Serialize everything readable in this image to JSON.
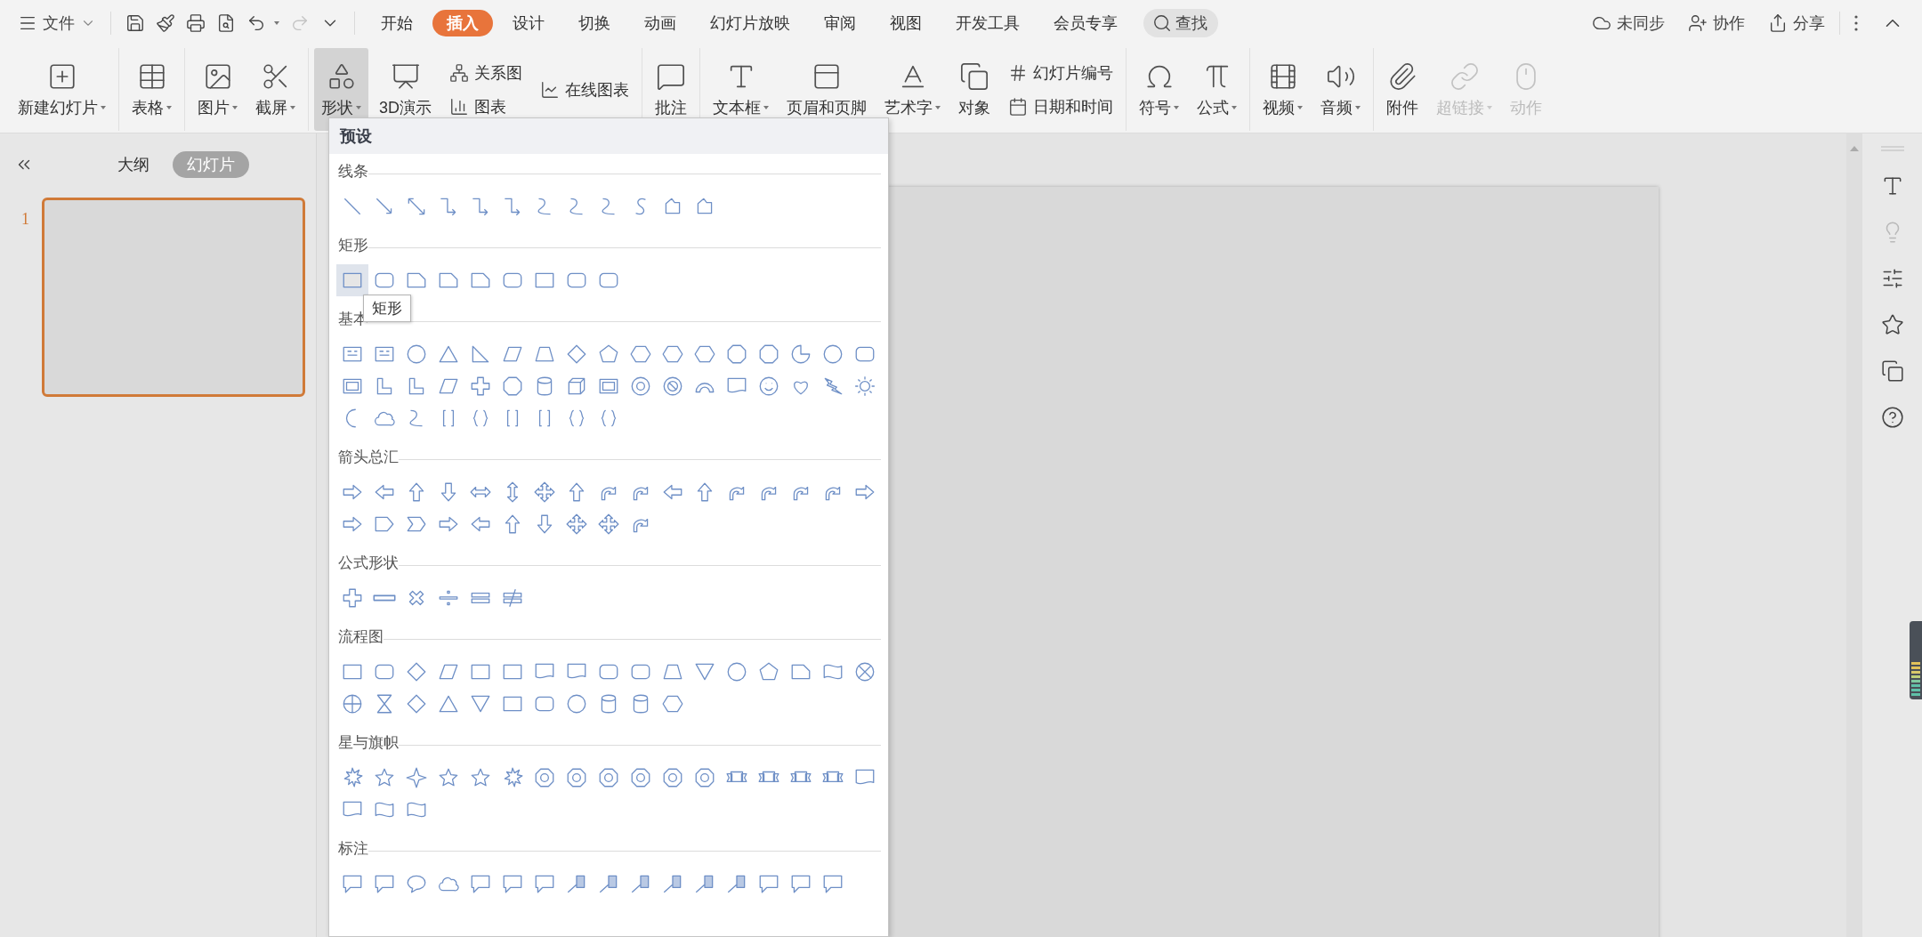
{
  "menu": {
    "label": "文件"
  },
  "quick_tools": [
    {
      "disabled": false
    },
    {
      "disabled": false
    },
    {
      "disabled": false
    },
    {
      "disabled": false
    },
    {
      "disabled": false
    },
    {
      "disabled": true
    },
    {
      "disabled": false
    }
  ],
  "tabs": [
    {
      "label": "开始",
      "selected": false
    },
    {
      "label": "插入",
      "selected": true
    },
    {
      "label": "设计",
      "selected": false
    },
    {
      "label": "切换",
      "selected": false
    },
    {
      "label": "动画",
      "selected": false
    },
    {
      "label": "幻灯片放映",
      "selected": false
    },
    {
      "label": "审阅",
      "selected": false
    },
    {
      "label": "视图",
      "selected": false
    },
    {
      "label": "开发工具",
      "selected": false
    },
    {
      "label": "会员专享",
      "selected": false
    }
  ],
  "search": {
    "label": "查找"
  },
  "account_actions": [
    {
      "label": "未同步"
    },
    {
      "label": "协作"
    },
    {
      "label": "分享"
    }
  ],
  "ribbon": {
    "groups": [
      {
        "items": [
          {
            "kind": "large",
            "label": "新建幻灯片",
            "dropdown": true,
            "pressed": false,
            "disabled": false
          }
        ]
      },
      {
        "items": [
          {
            "kind": "large",
            "label": "表格",
            "dropdown": true,
            "pressed": false,
            "disabled": false
          }
        ]
      },
      {
        "items": [
          {
            "kind": "large",
            "label": "图片",
            "dropdown": true,
            "pressed": false,
            "disabled": false
          },
          {
            "kind": "large",
            "label": "截屏",
            "dropdown": true,
            "pressed": false,
            "disabled": false
          }
        ]
      },
      {
        "items": [
          {
            "kind": "large",
            "label": "形状",
            "dropdown": true,
            "pressed": true,
            "disabled": false
          },
          {
            "kind": "large",
            "label": "3D演示",
            "dropdown": false,
            "pressed": false,
            "disabled": false
          },
          {
            "kind": "stack",
            "items": [
              {
                "label": "关系图"
              },
              {
                "label": "图表"
              }
            ]
          },
          {
            "kind": "stack",
            "items": [
              {
                "label": "在线图表"
              }
            ]
          }
        ]
      },
      {
        "items": [
          {
            "kind": "large",
            "label": "批注",
            "dropdown": false,
            "pressed": false,
            "disabled": false
          }
        ]
      },
      {
        "items": [
          {
            "kind": "large",
            "label": "文本框",
            "dropdown": true,
            "pressed": false,
            "disabled": false
          },
          {
            "kind": "large",
            "label": "页眉和页脚",
            "dropdown": false,
            "pressed": false,
            "disabled": false
          },
          {
            "kind": "large",
            "label": "艺术字",
            "dropdown": true,
            "pressed": false,
            "disabled": false
          },
          {
            "kind": "large",
            "label": "对象",
            "dropdown": false,
            "pressed": false,
            "disabled": false
          },
          {
            "kind": "stack",
            "items": [
              {
                "label": "幻灯片编号"
              },
              {
                "label": "日期和时间"
              }
            ]
          }
        ]
      },
      {
        "items": [
          {
            "kind": "large",
            "label": "符号",
            "dropdown": true,
            "pressed": false,
            "disabled": false
          },
          {
            "kind": "large",
            "label": "公式",
            "dropdown": true,
            "pressed": false,
            "disabled": false
          }
        ]
      },
      {
        "items": [
          {
            "kind": "large",
            "label": "视频",
            "dropdown": true,
            "pressed": false,
            "disabled": false
          },
          {
            "kind": "large",
            "label": "音频",
            "dropdown": true,
            "pressed": false,
            "disabled": false
          }
        ]
      },
      {
        "items": [
          {
            "kind": "large",
            "label": "附件",
            "dropdown": false,
            "pressed": false,
            "disabled": false
          },
          {
            "kind": "large",
            "label": "超链接",
            "dropdown": true,
            "pressed": false,
            "disabled": true
          },
          {
            "kind": "large",
            "label": "动作",
            "dropdown": false,
            "pressed": false,
            "disabled": true
          }
        ]
      }
    ]
  },
  "view_tabs": [
    {
      "label": "大纲",
      "selected": false
    },
    {
      "label": "幻灯片",
      "selected": true
    }
  ],
  "slides": [
    {
      "number": "1",
      "selected": true
    }
  ],
  "side_tools": [
    {
      "disabled": false
    },
    {
      "disabled": true
    },
    {
      "disabled": false
    },
    {
      "disabled": false
    },
    {
      "disabled": false
    },
    {
      "disabled": false
    }
  ],
  "shape_menu": {
    "header": "预设",
    "tooltip": "矩形",
    "sections": [
      {
        "title": "线条",
        "shapes": [
          {
            "selected": false
          },
          {
            "selected": false
          },
          {
            "selected": false
          },
          {
            "selected": false
          },
          {
            "selected": false
          },
          {
            "selected": false
          },
          {
            "selected": false
          },
          {
            "selected": false
          },
          {
            "selected": false
          },
          {
            "selected": false
          },
          {
            "selected": false
          },
          {
            "selected": false
          }
        ]
      },
      {
        "title": "矩形",
        "shapes": [
          {
            "selected": true
          },
          {
            "selected": false
          },
          {
            "selected": false
          },
          {
            "selected": false
          },
          {
            "selected": false
          },
          {
            "selected": false
          },
          {
            "selected": false
          },
          {
            "selected": false
          },
          {
            "selected": false
          }
        ]
      },
      {
        "title": "基本",
        "shapes": [
          {
            "selected": false
          },
          {
            "selected": false
          },
          {
            "selected": false
          },
          {
            "selected": false
          },
          {
            "selected": false
          },
          {
            "selected": false
          },
          {
            "selected": false
          },
          {
            "selected": false
          },
          {
            "selected": false
          },
          {
            "selected": false
          },
          {
            "selected": false
          },
          {
            "selected": false
          },
          {
            "selected": false
          },
          {
            "selected": false
          },
          {
            "selected": false
          },
          {
            "selected": false
          },
          {
            "selected": false
          },
          {
            "selected": false
          },
          {
            "selected": false
          },
          {
            "selected": false
          },
          {
            "selected": false
          },
          {
            "selected": false
          },
          {
            "selected": false
          },
          {
            "selected": false
          },
          {
            "selected": false
          },
          {
            "selected": false
          },
          {
            "selected": false
          },
          {
            "selected": false
          },
          {
            "selected": false
          },
          {
            "selected": false
          },
          {
            "selected": false
          },
          {
            "selected": false
          },
          {
            "selected": false
          },
          {
            "selected": false
          },
          {
            "selected": false
          },
          {
            "selected": false
          },
          {
            "selected": false
          },
          {
            "selected": false
          },
          {
            "selected": false
          },
          {
            "selected": false
          },
          {
            "selected": false
          },
          {
            "selected": false
          },
          {
            "selected": false
          }
        ]
      },
      {
        "title": "箭头总汇",
        "shapes": [
          {
            "selected": false
          },
          {
            "selected": false
          },
          {
            "selected": false
          },
          {
            "selected": false
          },
          {
            "selected": false
          },
          {
            "selected": false
          },
          {
            "selected": false
          },
          {
            "selected": false
          },
          {
            "selected": false
          },
          {
            "selected": false
          },
          {
            "selected": false
          },
          {
            "selected": false
          },
          {
            "selected": false
          },
          {
            "selected": false
          },
          {
            "selected": false
          },
          {
            "selected": false
          },
          {
            "selected": false
          },
          {
            "selected": false
          },
          {
            "selected": false
          },
          {
            "selected": false
          },
          {
            "selected": false
          },
          {
            "selected": false
          },
          {
            "selected": false
          },
          {
            "selected": false
          },
          {
            "selected": false
          },
          {
            "selected": false
          },
          {
            "selected": false
          }
        ]
      },
      {
        "title": "公式形状",
        "shapes": [
          {
            "selected": false
          },
          {
            "selected": false
          },
          {
            "selected": false
          },
          {
            "selected": false
          },
          {
            "selected": false
          },
          {
            "selected": false
          }
        ]
      },
      {
        "title": "流程图",
        "shapes": [
          {
            "selected": false
          },
          {
            "selected": false
          },
          {
            "selected": false
          },
          {
            "selected": false
          },
          {
            "selected": false
          },
          {
            "selected": false
          },
          {
            "selected": false
          },
          {
            "selected": false
          },
          {
            "selected": false
          },
          {
            "selected": false
          },
          {
            "selected": false
          },
          {
            "selected": false
          },
          {
            "selected": false
          },
          {
            "selected": false
          },
          {
            "selected": false
          },
          {
            "selected": false
          },
          {
            "selected": false
          },
          {
            "selected": false
          },
          {
            "selected": false
          },
          {
            "selected": false
          },
          {
            "selected": false
          },
          {
            "selected": false
          },
          {
            "selected": false
          },
          {
            "selected": false
          },
          {
            "selected": false
          },
          {
            "selected": false
          },
          {
            "selected": false
          },
          {
            "selected": false
          }
        ]
      },
      {
        "title": "星与旗帜",
        "shapes": [
          {
            "selected": false
          },
          {
            "selected": false
          },
          {
            "selected": false
          },
          {
            "selected": false
          },
          {
            "selected": false
          },
          {
            "selected": false
          },
          {
            "selected": false
          },
          {
            "selected": false
          },
          {
            "selected": false
          },
          {
            "selected": false
          },
          {
            "selected": false
          },
          {
            "selected": false
          },
          {
            "selected": false
          },
          {
            "selected": false
          },
          {
            "selected": false
          },
          {
            "selected": false
          },
          {
            "selected": false
          },
          {
            "selected": false
          },
          {
            "selected": false
          },
          {
            "selected": false
          }
        ]
      },
      {
        "title": "标注",
        "shapes": [
          {
            "selected": false
          },
          {
            "selected": false
          },
          {
            "selected": false
          },
          {
            "selected": false
          },
          {
            "selected": false
          },
          {
            "selected": false
          },
          {
            "selected": false
          },
          {
            "selected": false
          },
          {
            "selected": false
          },
          {
            "selected": false
          },
          {
            "selected": false
          },
          {
            "selected": false
          },
          {
            "selected": false
          },
          {
            "selected": false
          },
          {
            "selected": false
          },
          {
            "selected": false
          }
        ]
      }
    ]
  }
}
